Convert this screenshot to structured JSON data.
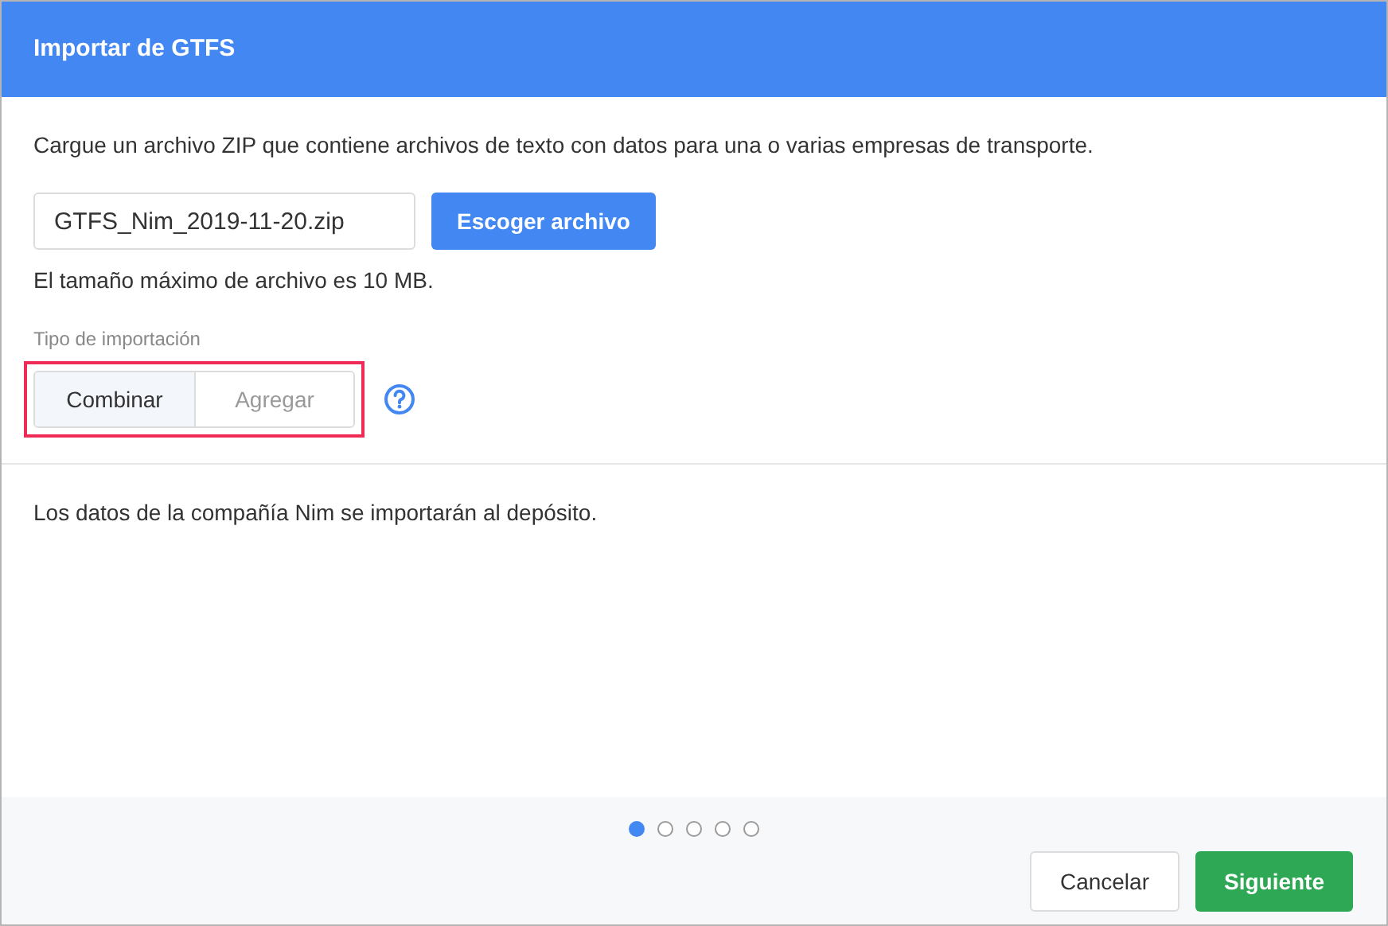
{
  "dialog": {
    "title": "Importar de GTFS"
  },
  "intro": "Cargue un archivo ZIP que contiene archivos de texto con datos para una o varias empresas de transporte.",
  "file": {
    "value": "GTFS_Nim_2019-11-20.zip",
    "button": "Escoger archivo",
    "hint": "El tamaño máximo de archivo es 10 MB."
  },
  "import_type": {
    "label": "Tipo de importación",
    "highlighted": true,
    "options": [
      {
        "label": "Combinar",
        "selected": true
      },
      {
        "label": "Agregar",
        "selected": false
      }
    ]
  },
  "message": "Los datos de la compañía Nim se importarán al depósito.",
  "steps": [
    {
      "selected": true
    },
    {
      "selected": false
    },
    {
      "selected": false
    },
    {
      "selected": false
    },
    {
      "selected": false
    }
  ],
  "buttons": [
    {
      "label": "Cancelar",
      "kind": "secondary"
    },
    {
      "label": "Siguiente",
      "kind": "primary"
    }
  ]
}
